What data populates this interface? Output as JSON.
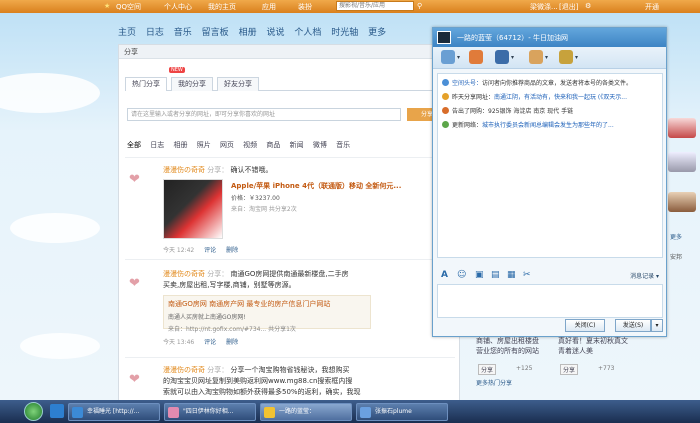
{
  "topbar": {
    "brand": "QQ空间",
    "center": "个人中心",
    "home": "我的主页",
    "apps": "应用",
    "decorate": "装扮",
    "search_placeholder": "搜影视/音乐/应用",
    "user": "梁微涤...",
    "logout": "[退出]",
    "open": "开通"
  },
  "page_nav": [
    "主页",
    "日志",
    "音乐",
    "留言板",
    "相册",
    "说说",
    "个人档",
    "时光轴",
    "更多"
  ],
  "share": {
    "header": "分享",
    "tabs": [
      "热门分享",
      "我的分享",
      "好友分享"
    ],
    "badge": "NEW",
    "input_placeholder": "请在这里输入或者分享的网址，即可分享你喜欢的网址",
    "share_button": "分享",
    "filters": [
      "全部",
      "日志",
      "相册",
      "照片",
      "网页",
      "视频",
      "商品",
      "新闻",
      "微博",
      "音乐"
    ]
  },
  "posts": [
    {
      "name": "漫漫伤の奇奇",
      "verb": "分享：",
      "text": "确认不错哦。",
      "product_title": "Apple/苹果 iPhone 4代（联通版）移动 全新何元...",
      "price": "价格：￥3237.00",
      "from": "来自：淘宝网  共分享2次",
      "time": "今天 12:42",
      "comment": "评论",
      "delete": "删除"
    },
    {
      "name": "漫漫伤の奇奇",
      "verb": "分享：",
      "text": "南通GO房网提供南通最新楼盘,二手房",
      "text2": "买卖,房屋出租,写字楼,商铺，别墅等房源。",
      "quote_title": "南通GO房网 南通房产网 最专业的房产信息门户网站",
      "quote_sub": "南通人买房就上南通GO房网!",
      "quote_from": "来自：http://nt.gofix.com/#734...  共分享1次",
      "time": "今天 13:46",
      "comment": "评论",
      "delete": "删除"
    },
    {
      "name": "漫漫伤の奇奇",
      "verb": "分享：",
      "text": "分享一个淘宝购物省钱秘诀，我想购买",
      "text2": "的淘宝宝贝网址复制到美购返利网www.mg88.cn搜索框内搜",
      "text3": "索就可以由入淘宝购物如额外获得最多50%的返利，确实，我现"
    }
  ],
  "right_bottom": {
    "col1_line1": "商铺、房屋出租楼盘",
    "col1_line2": "营业您的所有的网站",
    "col2_line1": "真好看！夏末初秋真文",
    "col2_line2": "青着迷人美",
    "share_label": "分享",
    "count1": "+125",
    "count2": "+773",
    "more": "更多热门分享"
  },
  "right_col_labels": [
    "更多",
    "安邦",
    "+125"
  ],
  "chat": {
    "title": "一路的蓝莹（64712）- 牛日加油网",
    "messages": [
      {
        "prefix": "空间头号：",
        "text": "访问者向你推荐商品的文章，发送者将本号的各类文件。"
      },
      {
        "prefix": "昨天分享网址：",
        "text": "南通江阴，有活动有，快来和我一起玩 (《双天示..."
      },
      {
        "prefix": "",
        "text": "告出了网购：925银饰 海淀店 南京 现代 手链"
      },
      {
        "prefix": "更新网络：",
        "text": "城市执行委员会新闻总编辑会发生为那些年的了..."
      }
    ],
    "record_label": "消息记录",
    "close_button": "关闭(C)",
    "send_button": "发送(S)"
  },
  "taskbar": {
    "tasks": [
      "幸福睡光 [http://...",
      "\"四日伊林你好相...",
      "一路的蓝莹：",
      "张振石plume"
    ]
  }
}
